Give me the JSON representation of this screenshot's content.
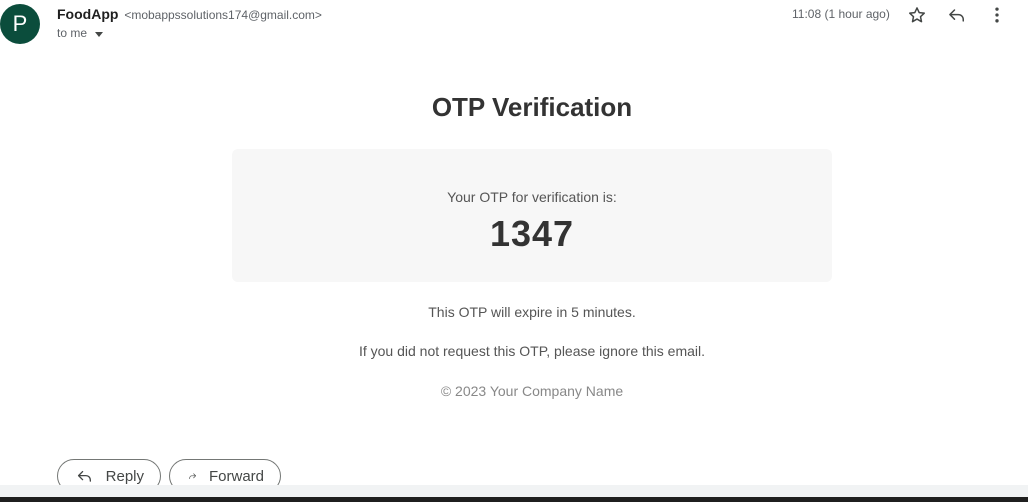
{
  "header": {
    "avatar_letter": "P",
    "sender_name": "FoodApp",
    "sender_email": "<mobappssolutions174@gmail.com>",
    "recipient_label": "to me",
    "timestamp": "11:08 (1 hour ago)",
    "icons": [
      "star-icon",
      "reply-icon",
      "more-vert-icon",
      "chevron-down-icon"
    ]
  },
  "body": {
    "title": "OTP Verification",
    "otp_label": "Your OTP for verification is:",
    "otp_code": "1347",
    "expire_note": "This OTP will expire in 5 minutes.",
    "ignore_note": "If you did not request this OTP, please ignore this email.",
    "footer": "© 2023 Your Company Name"
  },
  "actions": {
    "reply_label": "Reply",
    "forward_label": "Forward"
  },
  "colors": {
    "avatar_bg": "#0b4d3c",
    "otp_box_bg": "#f7f7f7",
    "text_dark": "#333333",
    "text_muted": "#555555",
    "footer_text": "#888888"
  }
}
